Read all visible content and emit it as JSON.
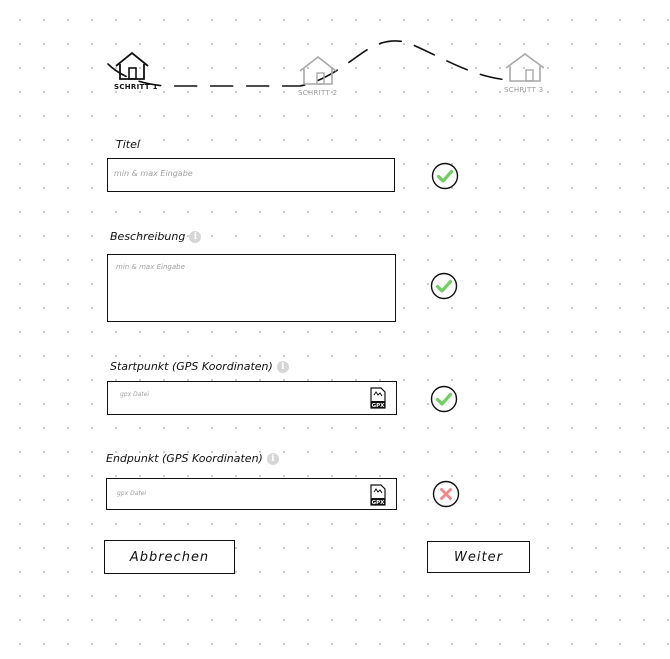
{
  "stepper": {
    "steps": [
      {
        "label": "SCHRITT 1",
        "state": "active"
      },
      {
        "label": "SCHRITT 2",
        "state": "inactive"
      },
      {
        "label": "SCHRITT 3",
        "state": "inactive"
      }
    ]
  },
  "form": {
    "title": {
      "label": "Titel",
      "placeholder": "min & max Eingabe",
      "status": "valid"
    },
    "description": {
      "label": "Beschreibung",
      "placeholder": "min & max Eingabe",
      "status": "valid"
    },
    "start_point": {
      "label": "Startpunkt (GPS Koordinaten)",
      "placeholder": "gpx Datei",
      "file_icon_text": "GPX",
      "status": "valid"
    },
    "end_point": {
      "label": "Endpunkt (GPS Koordinaten)",
      "placeholder": "gpx Datei",
      "file_icon_text": "GPX",
      "status": "invalid"
    }
  },
  "actions": {
    "cancel_label": "Abbrechen",
    "next_label": "Weiter"
  },
  "colors": {
    "valid_check": "#6fcf60",
    "invalid_cross": "#f08a8a",
    "active_step": "#111111",
    "inactive_step": "#a8a8a8"
  }
}
